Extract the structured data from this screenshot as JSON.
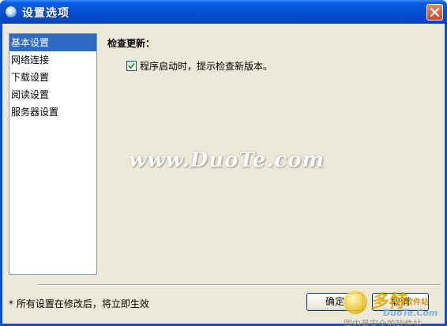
{
  "window": {
    "title": "设置选项"
  },
  "nav": {
    "items": [
      {
        "label": "基本设置",
        "selected": true
      },
      {
        "label": "网络连接",
        "selected": false
      },
      {
        "label": "下载设置",
        "selected": false
      },
      {
        "label": "阅读设置",
        "selected": false
      },
      {
        "label": "服务器设置",
        "selected": false
      }
    ]
  },
  "main": {
    "section_title": "检查更新：",
    "check_update": {
      "label": "程序启动时，提示检查新版本。",
      "checked": true
    }
  },
  "watermark": "www.DuoTe.com",
  "footer": {
    "note": "* 所有设置在修改后，将立即生效",
    "ok_label": "确定",
    "cancel_label": "取消"
  },
  "brand": {
    "name": "多特",
    "sub": "软件站",
    "url": "DuoTe.Com",
    "tagline": "国内最安全的软件站"
  },
  "colors": {
    "titlebar": "#0553d6",
    "selection": "#316ac5",
    "client": "#ece9d8",
    "close": "#d2461c"
  },
  "icons": {
    "app": "globe-icon",
    "close": "close-icon",
    "check": "checkmark-icon"
  }
}
